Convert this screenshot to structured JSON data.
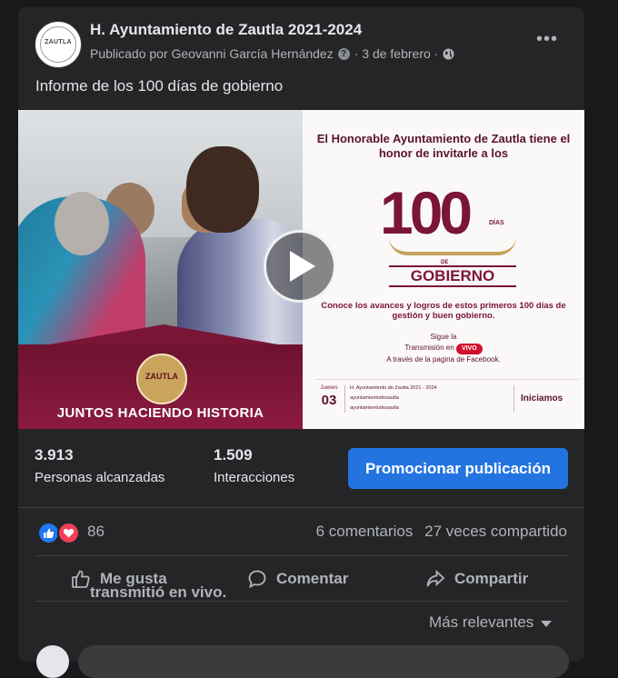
{
  "post": {
    "page_name": "H. Ayuntamiento de Zautla 2021-2024",
    "action_text": "transmitió en vivo.",
    "published_by": "Publicado por Geovanni García Hernández",
    "date": "· 3 de febrero ·",
    "text": "Informe de los 100 días de gobierno"
  },
  "avatar_text": "ZAUTLA",
  "media": {
    "banner_text": "JUNTOS HACIENDO HISTORIA",
    "seal_text": "ZAUTLA",
    "invite": "El Honorable Ayuntamiento de Zautla tiene el honor de invitarle a los",
    "big_number": "100",
    "days_small": "DÍAS",
    "de_small": "DE",
    "gobierno": "GOBIERNO",
    "avances": "Conoce los avances y logros de estos primeros 100 días de gestión y buen gobierno.",
    "sigue": "Sigue la",
    "transmision": "Transmisión en",
    "vivo": "VIVO",
    "facebook_line": "A través de la pagina de Facebook.",
    "jueves": "Jueves",
    "day_num": "03",
    "fb_page": "H. Ayuntamiento de Zautla 2021 - 2024",
    "instagram": "ayuntamientodezautla",
    "twitter": "ayuntamientodezautla",
    "iniciamos": "Iniciamos"
  },
  "stats": {
    "reach_value": "3.913",
    "reach_label": "Personas alcanzadas",
    "interactions_value": "1.509",
    "interactions_label": "Interacciones",
    "promote_button": "Promocionar publicación"
  },
  "reactions": {
    "count": "86",
    "comments": "6 comentarios",
    "shares": "27 veces compartido"
  },
  "actions": {
    "like": "Me gusta",
    "comment": "Comentar",
    "share": "Compartir"
  },
  "sort": {
    "label": "Más relevantes"
  },
  "colors": {
    "background": "#18191a",
    "card": "#242526",
    "primary_button": "#2374e1",
    "brand_maroon": "#7a1535"
  }
}
